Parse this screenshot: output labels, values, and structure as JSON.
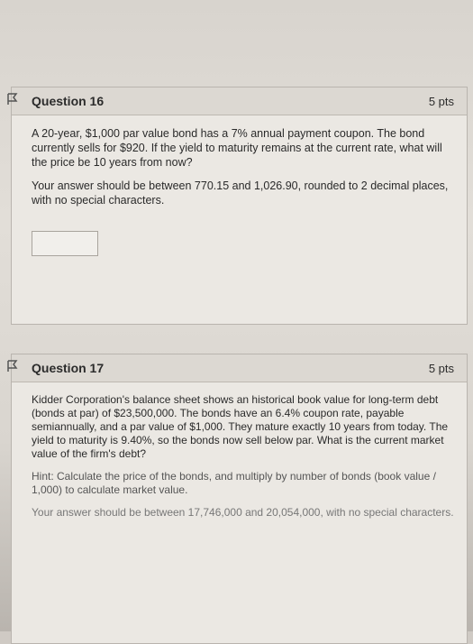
{
  "q16": {
    "title": "Question 16",
    "pts": "5 pts",
    "text": "A 20-year, $1,000 par value bond has a 7% annual payment coupon. The bond currently sells for $920. If the yield to maturity remains at the current rate, what will the price be 10 years from now?",
    "instruction": "Your answer should be between 770.15 and 1,026.90, rounded to 2 decimal places, with no special characters."
  },
  "q17": {
    "title": "Question 17",
    "pts": "5 pts",
    "text": "Kidder Corporation's balance sheet shows an historical book value for long-term debt (bonds at par) of $23,500,000. The bonds have an 6.4% coupon rate, payable semiannually, and a par value of $1,000. They mature exactly 10 years from today. The yield to maturity is 9.40%, so the bonds now sell below par. What is the current market value of the firm's debt?",
    "hint": "Hint: Calculate the price of the bonds, and multiply by number of bonds (book value / 1,000) to calculate market value.",
    "instruction": "Your answer should be between 17,746,000 and 20,054,000, with no special characters."
  }
}
